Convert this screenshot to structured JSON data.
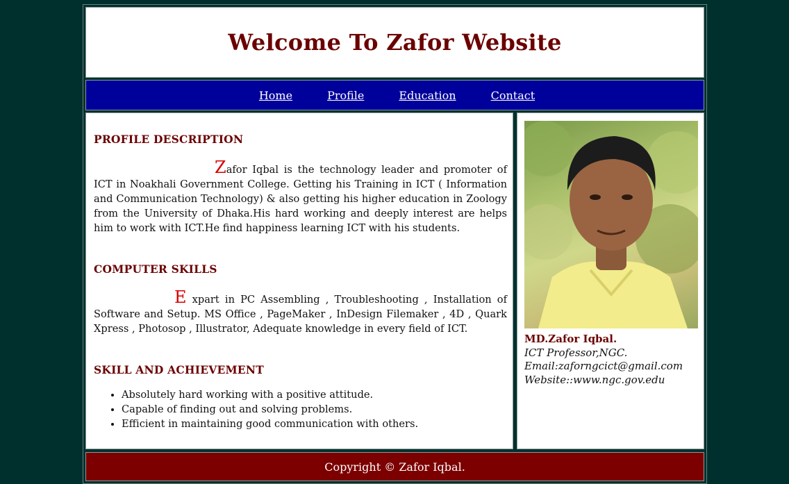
{
  "header": {
    "title": "Welcome To Zafor Website"
  },
  "nav": {
    "items": [
      "Home",
      "Profile",
      "Education",
      "Contact"
    ]
  },
  "profile": {
    "title": "PROFILE DESCRIPTION",
    "dropcap": "Z",
    "text": "afor Iqbal is the technology leader and promoter of ICT in Noakhali Government College. Getting his Training in ICT ( Information and Communication Technology) & also getting his higher education in Zoology from the University of Dhaka.His hard working and deeply interest are helps him to work with ICT.He find happiness learning ICT with his students."
  },
  "skills": {
    "title": "COMPUTER SKILLS",
    "dropcap": "E",
    "text": " xpart in PC Assembling , Troubleshooting , Installation of Software and Setup. MS Office , PageMaker , InDesign Filemaker , 4D , Quark Xpress , Photosop , Illustrator, Adequate knowledge in every field of ICT."
  },
  "achievement": {
    "title": "SKILL AND ACHIEVEMENT",
    "items": [
      "Absolutely hard working with a positive attitude.",
      "Capable of finding out and solving problems.",
      "Efficient in maintaining good communication with others."
    ]
  },
  "sidebar": {
    "name": "MD.Zafor Iqbal.",
    "role": "ICT Professor,NGC.",
    "email": "Email:zaforngcict@gmail.com",
    "website": "Website::www.ngc.gov.edu"
  },
  "footer": {
    "copyright": "Copyright © Zafor Iqbal."
  }
}
